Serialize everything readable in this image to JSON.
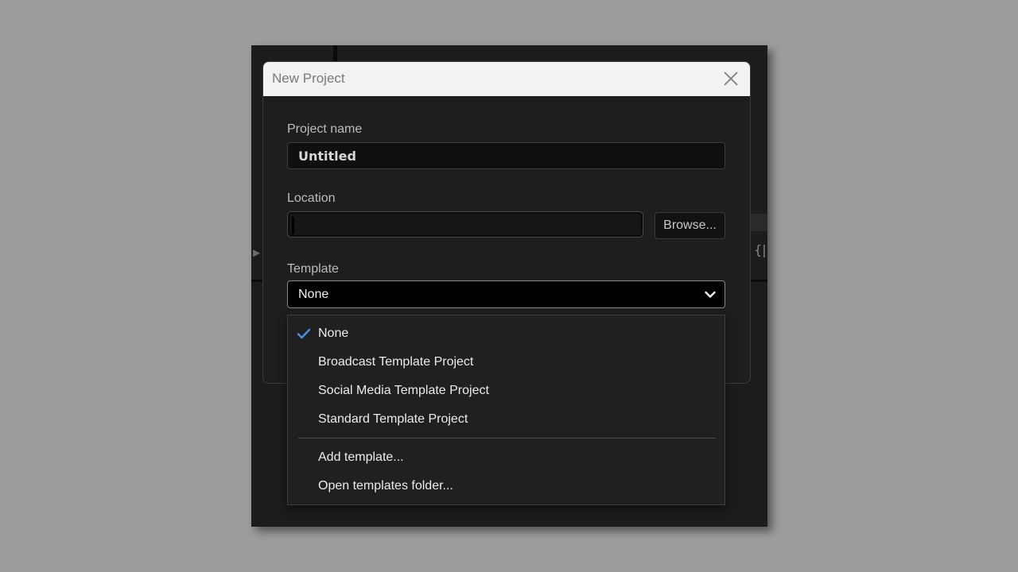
{
  "dialog": {
    "title": "New Project",
    "close_icon": "close-icon"
  },
  "form": {
    "project_name_label": "Project name",
    "project_name_value": "Untitled",
    "location_label": "Location",
    "location_value": "",
    "browse_label": "Browse...",
    "template_label": "Template",
    "template_selected": "None"
  },
  "dropdown": {
    "options": [
      {
        "label": "None",
        "selected": true
      },
      {
        "label": "Broadcast Template Project",
        "selected": false
      },
      {
        "label": "Social Media Template Project",
        "selected": false
      },
      {
        "label": "Standard Template Project",
        "selected": false
      }
    ],
    "actions": [
      {
        "label": "Add template..."
      },
      {
        "label": "Open templates folder..."
      }
    ]
  },
  "colors": {
    "page_background": "#9c9c9c",
    "dialog_background": "#1e1e1e",
    "titlebar_background": "#f2f2f2",
    "check_accent": "#4b8fe8"
  }
}
